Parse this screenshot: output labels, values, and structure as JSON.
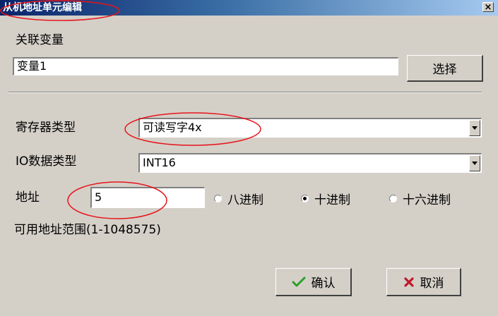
{
  "window": {
    "title": "从机地址单元编辑",
    "close_label": "×"
  },
  "linked_var": {
    "label": "关联变量",
    "value": "变量1",
    "select_button": "选择"
  },
  "register_type": {
    "label": "寄存器类型",
    "value": "可读写字4x"
  },
  "io_data_type": {
    "label": "IO数据类型",
    "value": "INT16"
  },
  "address": {
    "label": "地址",
    "value": "5",
    "radix": [
      {
        "label": "八进制",
        "checked": false
      },
      {
        "label": "十进制",
        "checked": true
      },
      {
        "label": "十六进制",
        "checked": false
      }
    ],
    "range_text": "可用地址范围(1-1048575)"
  },
  "buttons": {
    "ok": "确认",
    "cancel": "取消"
  },
  "colors": {
    "annotation": "#e8141a",
    "title_bar": "#0a246a",
    "ok_icon": "#2aa02a",
    "cancel_icon": "#c0182a"
  }
}
